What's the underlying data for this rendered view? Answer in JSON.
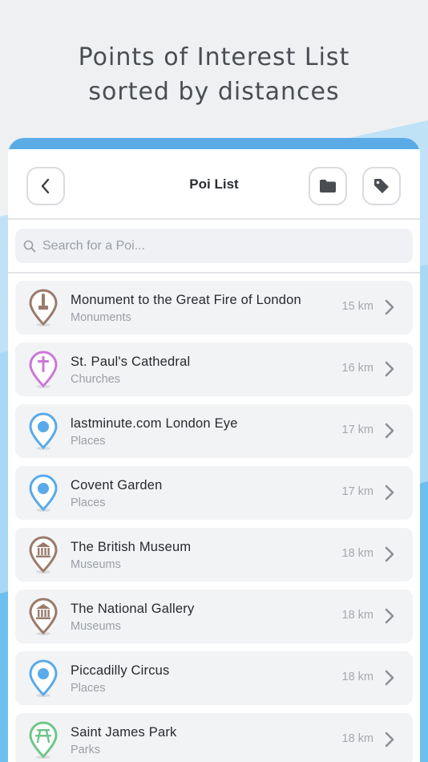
{
  "headline": {
    "line1": "Points of Interest List",
    "line2": "sorted by distances"
  },
  "colors": {
    "accent": "#5aabe6",
    "monuments": "#9a7a6a",
    "churches": "#cc77d8",
    "places": "#58aaea",
    "museums": "#9a7a6a",
    "parks": "#6ec68a"
  },
  "navbar": {
    "title": "Poi List",
    "back_icon": "chevron-left-icon",
    "folder_icon": "folder-icon",
    "tag_icon": "tag-icon"
  },
  "search": {
    "placeholder": "Search for a Poi...",
    "value": "",
    "icon": "search-icon"
  },
  "pois": [
    {
      "name": "Monument to the Great Fire of London",
      "category": "Monuments",
      "distance": "15 km",
      "icon": "monument-icon",
      "color": "#9a7a6a"
    },
    {
      "name": "St. Paul's Cathedral",
      "category": "Churches",
      "distance": "16 km",
      "icon": "cross-icon",
      "color": "#cc77d8"
    },
    {
      "name": "lastminute.com London Eye",
      "category": "Places",
      "distance": "17 km",
      "icon": "place-dot-icon",
      "color": "#58aaea"
    },
    {
      "name": "Covent Garden",
      "category": "Places",
      "distance": "17 km",
      "icon": "place-dot-icon",
      "color": "#58aaea"
    },
    {
      "name": "The British Museum",
      "category": "Museums",
      "distance": "18 km",
      "icon": "museum-icon",
      "color": "#9a7a6a"
    },
    {
      "name": "The National Gallery",
      "category": "Museums",
      "distance": "18 km",
      "icon": "museum-icon",
      "color": "#9a7a6a"
    },
    {
      "name": "Piccadilly Circus",
      "category": "Places",
      "distance": "18 km",
      "icon": "place-dot-icon",
      "color": "#58aaea"
    },
    {
      "name": "Saint James Park",
      "category": "Parks",
      "distance": "18 km",
      "icon": "picnic-table-icon",
      "color": "#6ec68a"
    }
  ]
}
